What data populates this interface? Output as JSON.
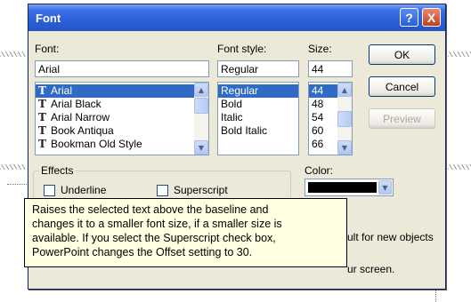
{
  "dialog": {
    "title": "Font",
    "help_button": "?",
    "close_button": "X"
  },
  "font": {
    "label": "Font:",
    "value": "Arial",
    "items": [
      "Arial",
      "Arial Black",
      "Arial Narrow",
      "Book Antiqua",
      "Bookman Old Style"
    ],
    "selected": "Arial",
    "item_icon": "truetype-icon"
  },
  "font_style": {
    "label": "Font style:",
    "value": "Regular",
    "items": [
      "Regular",
      "Bold",
      "Italic",
      "Bold Italic"
    ],
    "selected": "Regular"
  },
  "size": {
    "label": "Size:",
    "value": "44",
    "items": [
      "44",
      "48",
      "54",
      "60",
      "66"
    ],
    "selected": "44"
  },
  "buttons": {
    "ok": "OK",
    "cancel": "Cancel",
    "preview": "Preview"
  },
  "effects": {
    "label": "Effects",
    "underline": "Underline",
    "superscript": "Superscript"
  },
  "color": {
    "label": "Color:",
    "value": "#000000"
  },
  "partial": {
    "default_text": "ult for new objects",
    "screen_text": "ur screen."
  },
  "tooltip": {
    "lines": [
      "Raises the selected text above the baseline and",
      "changes it to a smaller font size, if a smaller size is",
      "available. If you select the Superscript check box,",
      "PowerPoint changes the Offset setting to 30."
    ]
  },
  "colors": {
    "title_bar": "#2a5fd9",
    "dialog_bg": "#ece9d8",
    "selection": "#316ac5",
    "tooltip_bg": "#ffffe1",
    "close_button": "#c4401b"
  }
}
